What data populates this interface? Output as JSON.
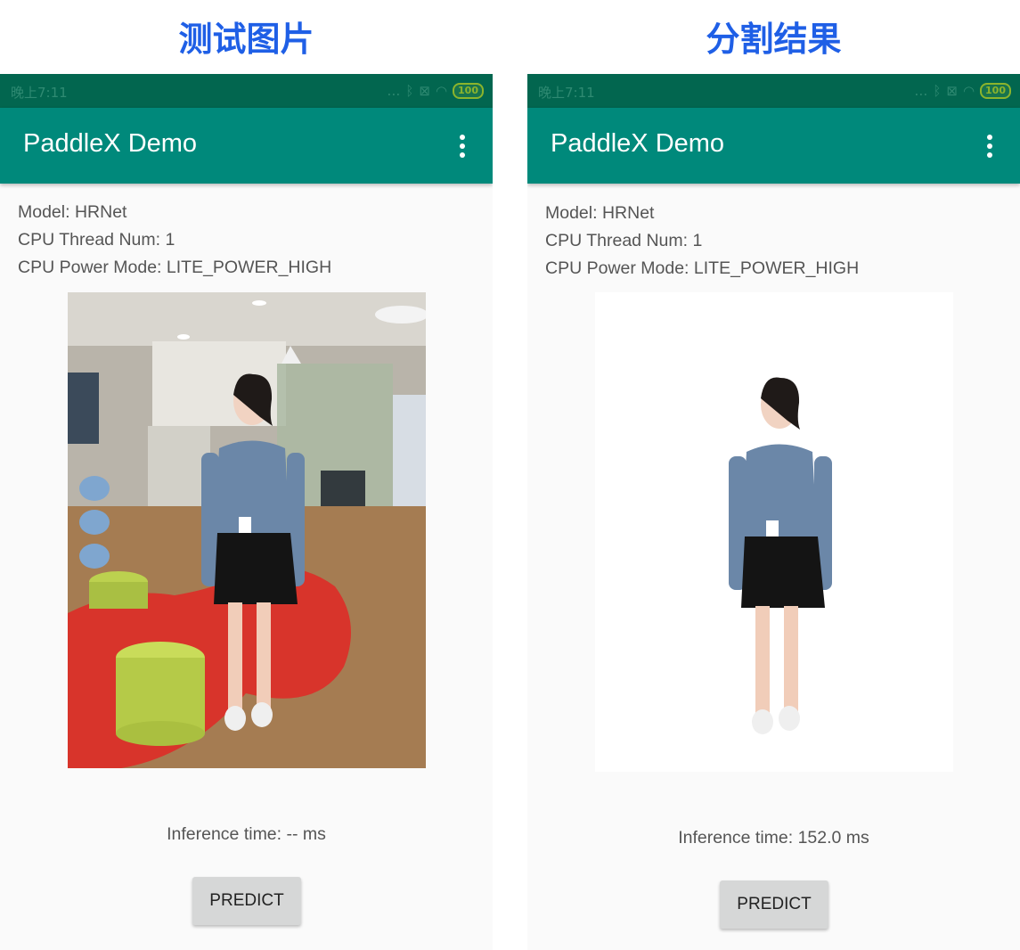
{
  "captions": {
    "left": "测试图片",
    "right": "分割结果"
  },
  "status_bar": {
    "time": "晚上7:11",
    "battery": "100"
  },
  "app": {
    "title": "PaddleX Demo"
  },
  "info": {
    "model": "Model: HRNet",
    "threads": "CPU Thread Num: 1",
    "power_mode": "CPU Power Mode: LITE_POWER_HIGH"
  },
  "left_panel": {
    "inference": "Inference time: -- ms",
    "predict_label": "PREDICT"
  },
  "right_panel": {
    "inference": "Inference time: 152.0 ms",
    "predict_label": "PREDICT"
  },
  "colors": {
    "caption": "#1f5fe6",
    "status_bar": "#02664f",
    "app_bar": "#00897b",
    "button": "#d6d7d7"
  }
}
